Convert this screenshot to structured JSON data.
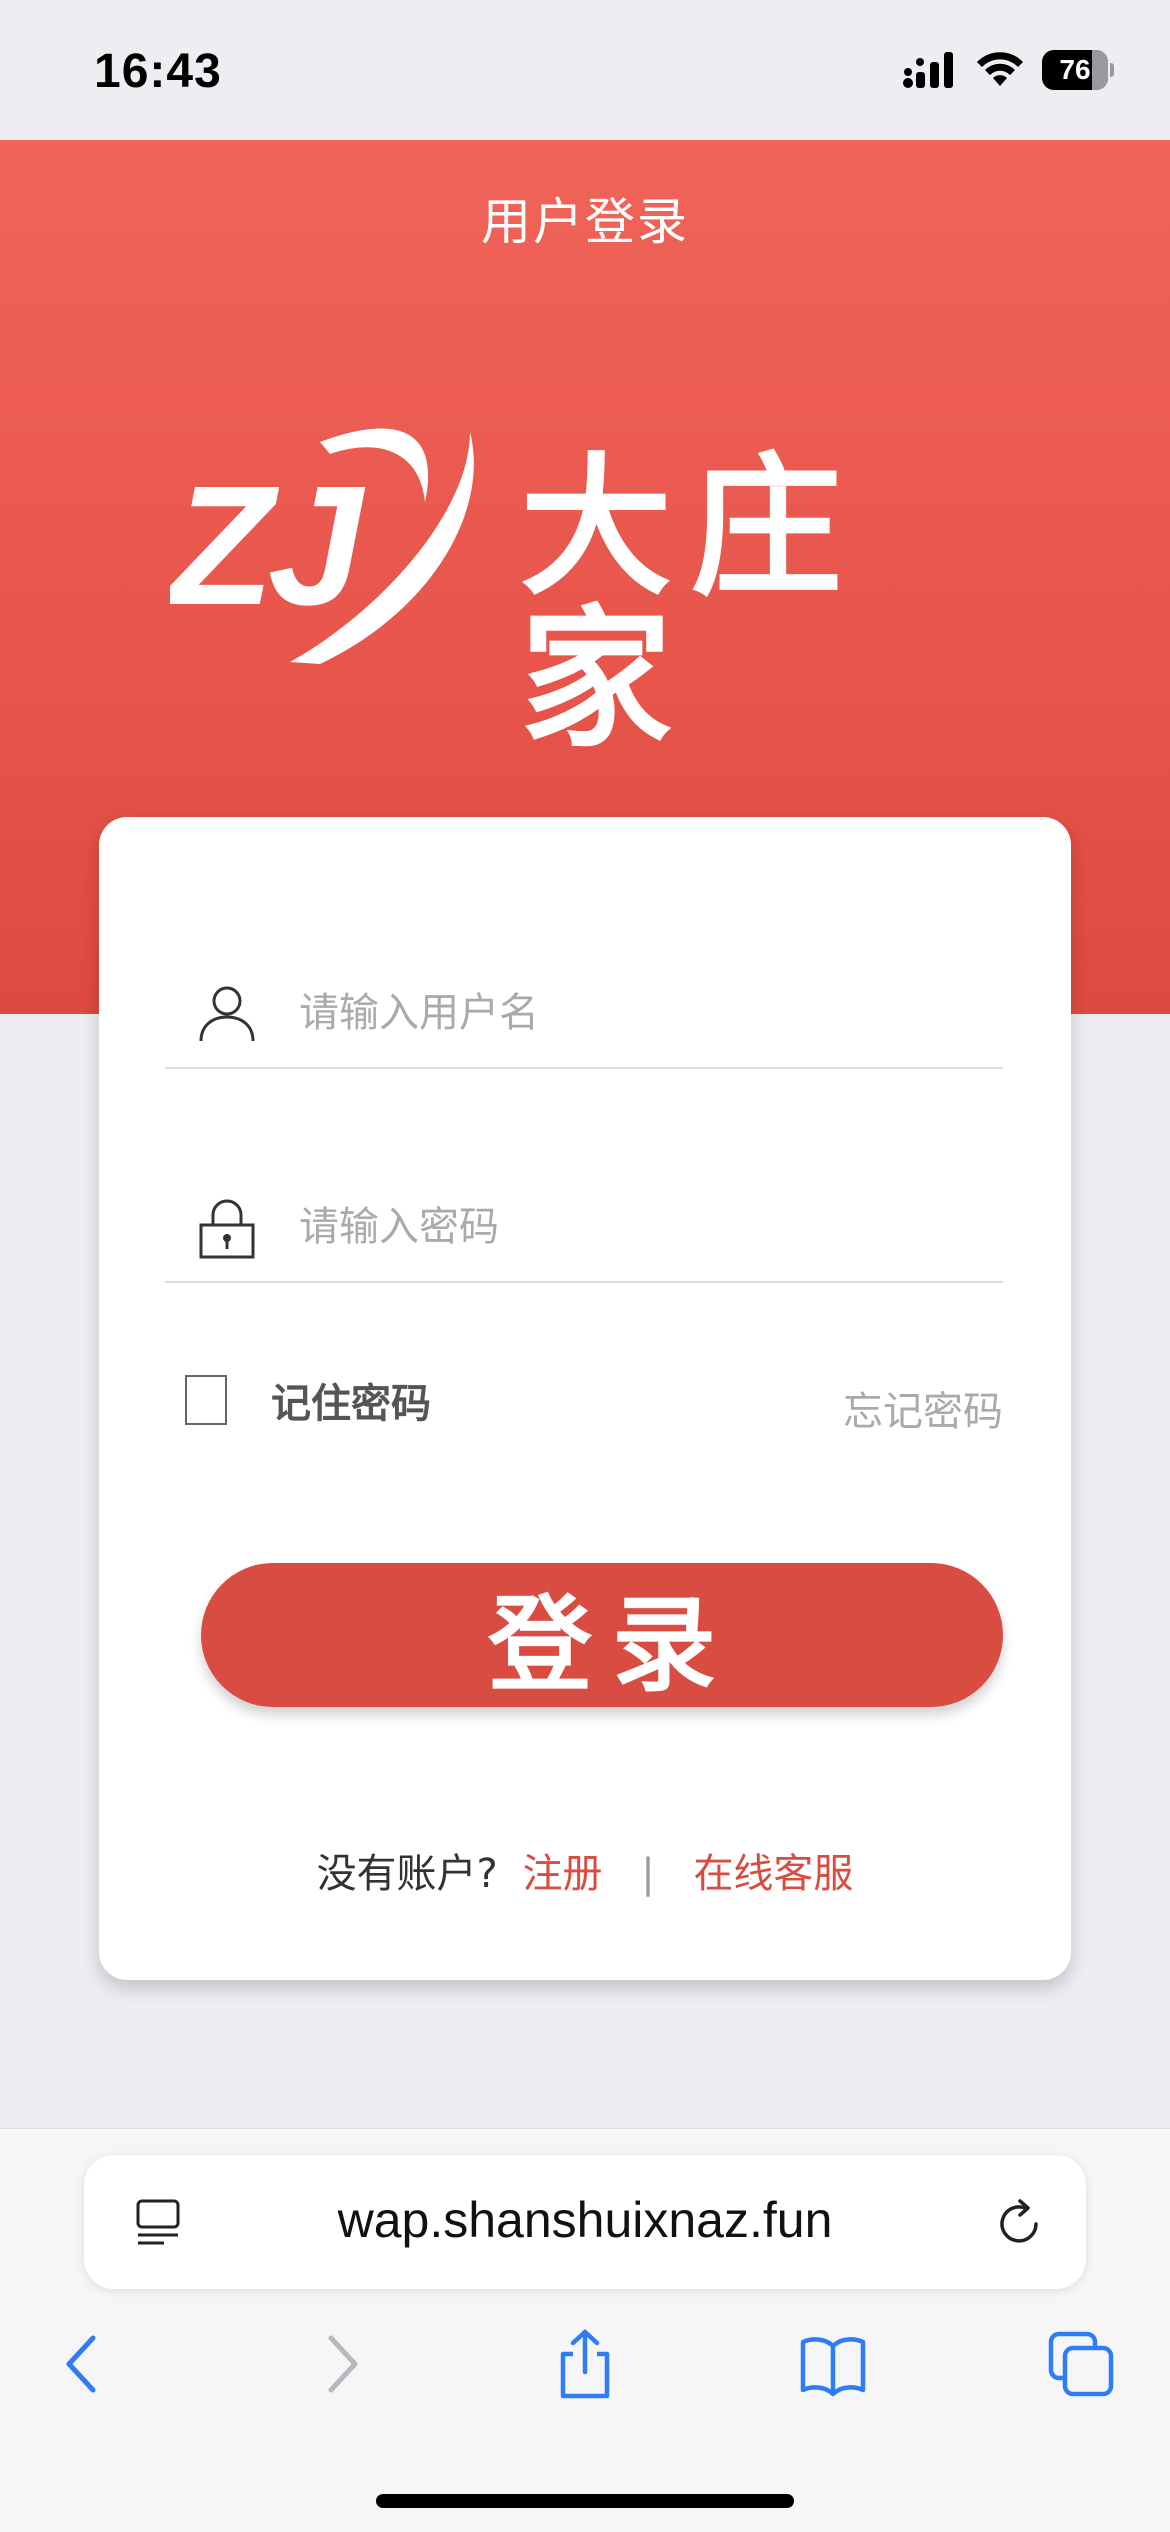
{
  "status_bar": {
    "time": "16:43",
    "battery_level": "76",
    "icons": [
      "signal-icon",
      "wifi-icon",
      "battery-icon"
    ]
  },
  "header": {
    "title": "用户登录",
    "logo_mark": "ZJ",
    "logo_text": "大庄家"
  },
  "login_form": {
    "username_placeholder": "请输入用户名",
    "password_placeholder": "请输入密码",
    "username_icon": "user-icon",
    "password_icon": "lock-icon",
    "remember_label": "记住密码",
    "remember_checked": false,
    "forgot_label": "忘记密码",
    "login_button_label": "登录",
    "no_account_text": "没有账户?",
    "register_link": "注册",
    "separator": "|",
    "support_link": "在线客服"
  },
  "browser": {
    "url": "wap.shanshuixnaz.fun",
    "toolbar_icons": [
      "back-icon",
      "forward-icon",
      "share-icon",
      "bookmarks-icon",
      "tabs-icon"
    ]
  },
  "colors": {
    "brand_red": "#d94c41",
    "header_red": "#e8564c",
    "background": "#ededf2",
    "placeholder": "#aaaaaa",
    "ios_blue": "#2f7cf6"
  }
}
